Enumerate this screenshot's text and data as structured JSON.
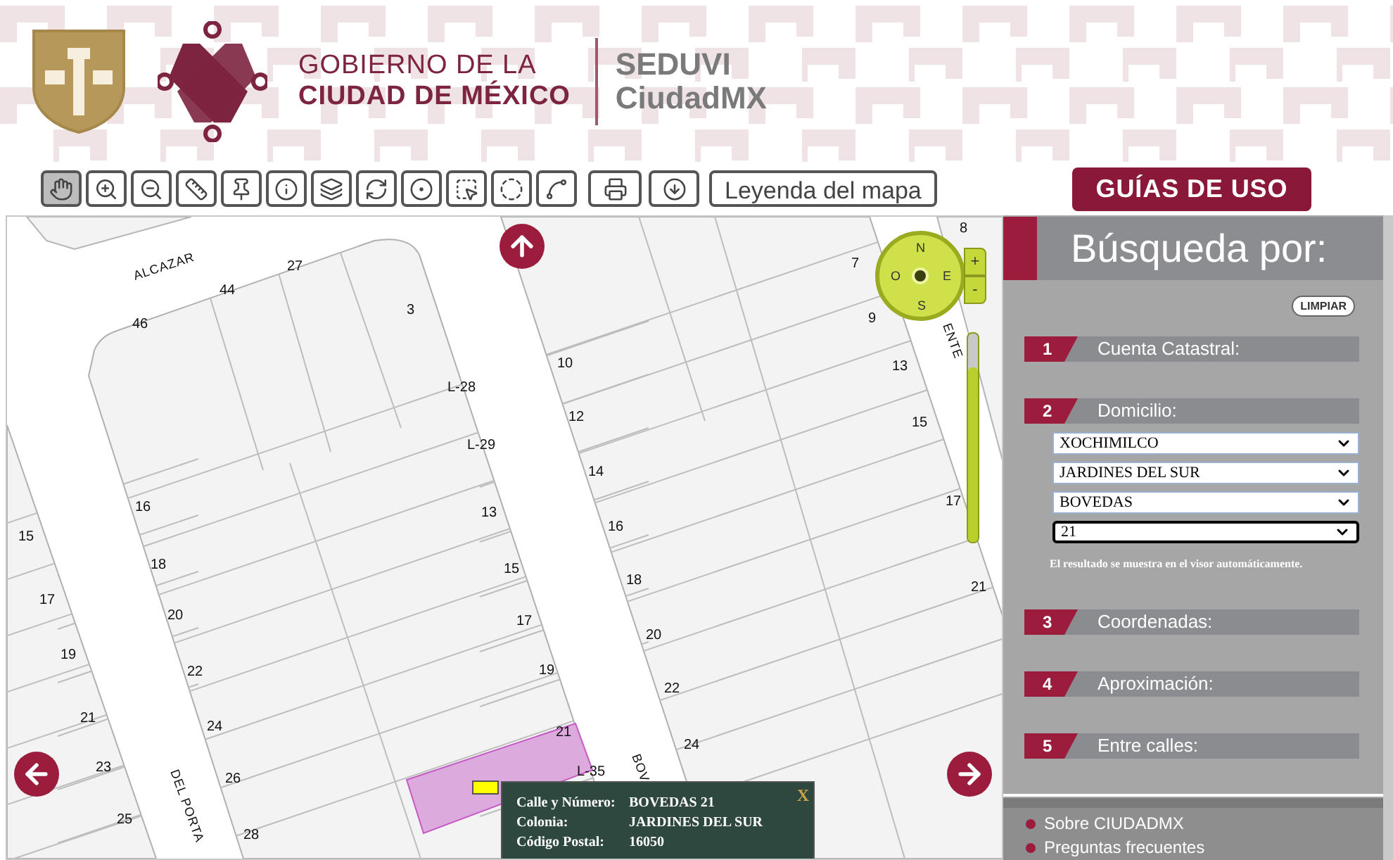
{
  "header": {
    "line_1": "GOBIERNO DE LA",
    "line_2": "CIUDAD DE MÉXICO",
    "app_line_1": "SEDUVI",
    "app_line_2": "CiudadMX"
  },
  "toolbar": {
    "tools": [
      {
        "kind": "pan",
        "selected": true
      },
      {
        "kind": "zoom_in",
        "selected": false
      },
      {
        "kind": "zoom_out",
        "selected": false
      },
      {
        "kind": "measure",
        "selected": false
      },
      {
        "kind": "pin",
        "selected": false
      },
      {
        "kind": "info",
        "selected": false
      },
      {
        "kind": "layers",
        "selected": false
      },
      {
        "kind": "refresh",
        "selected": false
      },
      {
        "kind": "buffer",
        "selected": false
      },
      {
        "kind": "select_rect",
        "selected": false
      },
      {
        "kind": "select_circle",
        "selected": false
      },
      {
        "kind": "select_polygon",
        "selected": false
      },
      {
        "kind": "print",
        "selected": false
      },
      {
        "kind": "download",
        "selected": false
      }
    ],
    "legend_button": "Leyenda del mapa"
  },
  "map": {
    "labels": [
      {
        "text": "ALCAZAR",
        "kind": "street"
      },
      {
        "text": "44",
        "kind": "lot"
      },
      {
        "text": "27",
        "kind": "lot"
      },
      {
        "text": "46",
        "kind": "lot"
      },
      {
        "text": "3",
        "kind": "lot"
      },
      {
        "text": "L-28",
        "kind": "lot"
      },
      {
        "text": "L-29",
        "kind": "lot"
      },
      {
        "text": "10",
        "kind": "lot"
      },
      {
        "text": "12",
        "kind": "lot"
      },
      {
        "text": "14",
        "kind": "lot"
      },
      {
        "text": "16",
        "kind": "lot"
      },
      {
        "text": "13",
        "kind": "lot"
      },
      {
        "text": "15",
        "kind": "lot"
      },
      {
        "text": "18",
        "kind": "lot"
      },
      {
        "text": "15",
        "kind": "lot"
      },
      {
        "text": "16",
        "kind": "lot"
      },
      {
        "text": "17",
        "kind": "lot"
      },
      {
        "text": "20",
        "kind": "lot"
      },
      {
        "text": "17",
        "kind": "lot"
      },
      {
        "text": "18",
        "kind": "lot"
      },
      {
        "text": "19",
        "kind": "lot"
      },
      {
        "text": "22",
        "kind": "lot"
      },
      {
        "text": "19",
        "kind": "lot"
      },
      {
        "text": "20",
        "kind": "lot"
      },
      {
        "text": "21",
        "kind": "lot"
      },
      {
        "text": "24",
        "kind": "lot"
      },
      {
        "text": "21",
        "kind": "lot"
      },
      {
        "text": "22",
        "kind": "lot"
      },
      {
        "text": "23",
        "kind": "lot"
      },
      {
        "text": "26",
        "kind": "lot"
      },
      {
        "text": "L-35",
        "kind": "lot"
      },
      {
        "text": "24",
        "kind": "lot"
      },
      {
        "text": "25",
        "kind": "lot"
      },
      {
        "text": "28",
        "kind": "lot"
      },
      {
        "text": "BOV",
        "kind": "street"
      },
      {
        "text": "DEL PORTA",
        "kind": "street"
      },
      {
        "text": "7",
        "kind": "lot"
      },
      {
        "text": "8",
        "kind": "lot"
      },
      {
        "text": "9",
        "kind": "lot"
      },
      {
        "text": "13",
        "kind": "lot"
      },
      {
        "text": "15",
        "kind": "lot"
      },
      {
        "text": "17",
        "kind": "lot"
      },
      {
        "text": "21",
        "kind": "lot"
      },
      {
        "text": "ENTE",
        "kind": "street"
      }
    ],
    "compass": {
      "north": "N",
      "south": "S",
      "east": "E",
      "west": "O",
      "zoom_in": "+",
      "zoom_out": "-"
    },
    "zoom_slider": {
      "level": 0.84
    },
    "popup": {
      "close": "X",
      "rows": [
        {
          "label": "Calle y Número:",
          "value": "BOVEDAS 21"
        },
        {
          "label": "Colonia:",
          "value": "JARDINES DEL SUR"
        },
        {
          "label": "Código Postal:",
          "value": "16050"
        }
      ]
    }
  },
  "guides_button": "GUÍAS DE USO",
  "search_panel": {
    "title": "Búsqueda por:",
    "clear_button": "LIMPIAR",
    "sections": [
      {
        "number": "1",
        "label": "Cuenta Catastral:"
      },
      {
        "number": "2",
        "label": "Domicilio:",
        "selects": [
          {
            "value": "XOCHIMILCO",
            "focused": false
          },
          {
            "value": "JARDINES DEL SUR",
            "focused": false
          },
          {
            "value": "BOVEDAS",
            "focused": false
          },
          {
            "value": "21",
            "focused": true
          }
        ],
        "note": "El resultado se muestra en el visor automáticamente."
      },
      {
        "number": "3",
        "label": "Coordenadas:"
      },
      {
        "number": "4",
        "label": "Aproximación:"
      },
      {
        "number": "5",
        "label": "Entre calles:"
      }
    ],
    "links": [
      "Sobre CIUDADMX",
      "Preguntas frecuentes"
    ]
  }
}
